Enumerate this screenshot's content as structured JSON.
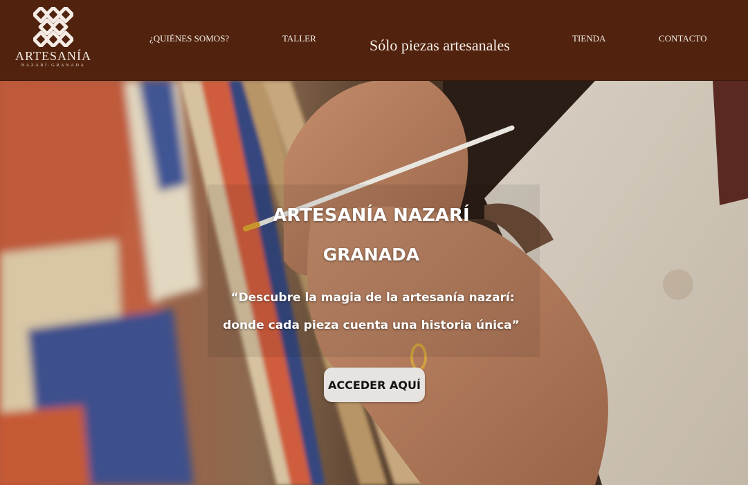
{
  "brand": {
    "title": "ARTESANÍA",
    "subtitle": "NAZARÍ·GRANADA",
    "logo_icon": "geometric-knot-logo"
  },
  "nav": {
    "items": [
      {
        "label": "¿QUIÉNES SOMOS?"
      },
      {
        "label": "TALLER"
      },
      {
        "label": "TIENDA"
      },
      {
        "label": "CONTACTO"
      }
    ]
  },
  "header": {
    "tagline": "Sólo piezas artesanales"
  },
  "hero": {
    "title_line1": "ARTESANÍA NAZARÍ",
    "title_line2": "GRANADA",
    "quote_line1": "“Descubre la magia de la artesanía nazarí:",
    "quote_line2": "donde cada pieza cuenta una historia única”",
    "cta_label": "ACCEDER AQUÍ",
    "image_subject": "artisan-hands-painting-nazari-plasterwork"
  },
  "colors": {
    "header_bg": "#51230f",
    "header_text": "#f4ece4",
    "cta_bg": "#e6e3e1",
    "hero_text": "#ffffff"
  }
}
